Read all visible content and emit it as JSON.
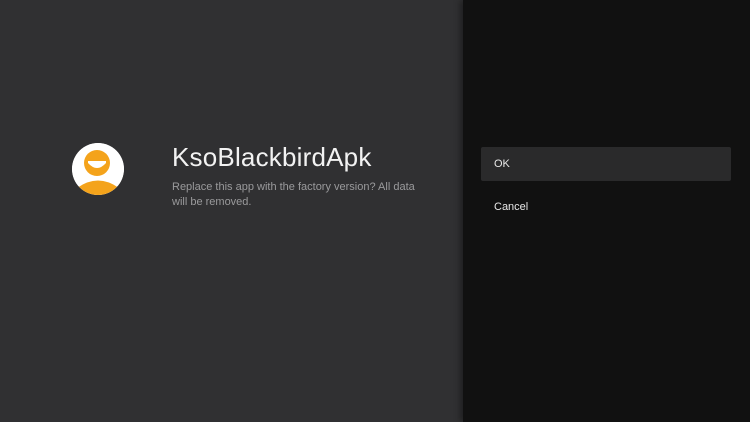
{
  "dialog": {
    "app_name": "KsoBlackbirdApk",
    "message": "Replace this app with the factory version? All data will be removed.",
    "icon": "orange-person-icon"
  },
  "actions": {
    "ok_label": "OK",
    "cancel_label": "Cancel"
  },
  "colors": {
    "icon_orange": "#f4a31b",
    "left_background": "#303032",
    "right_background": "#111111"
  }
}
